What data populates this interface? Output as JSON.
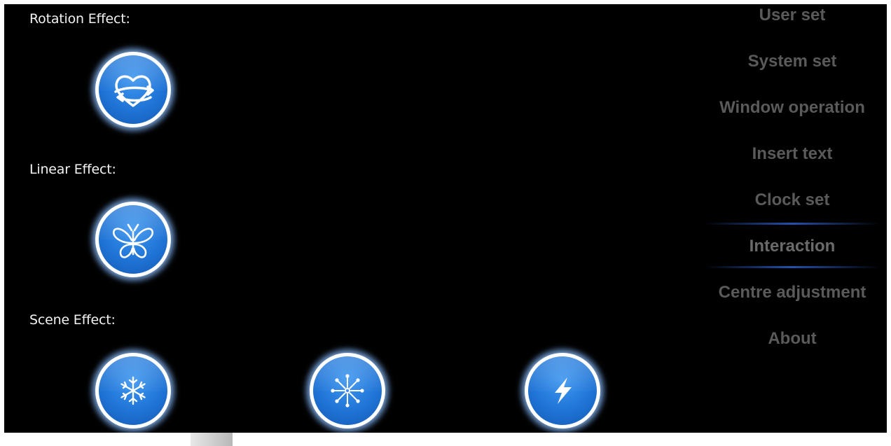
{
  "sections": {
    "rotation_label": "Rotation Effect:",
    "linear_label": "Linear Effect:",
    "scene_label": "Scene Effect:"
  },
  "buttons": {
    "rotation": "heart-arrows-icon",
    "linear": "butterfly-icon",
    "scene_1": "snowflake-icon",
    "scene_2": "firework-icon",
    "scene_3": "lightning-icon"
  },
  "menu": {
    "items": [
      {
        "label": "User set"
      },
      {
        "label": "System set"
      },
      {
        "label": "Window operation"
      },
      {
        "label": "Insert text"
      },
      {
        "label": "Clock set"
      },
      {
        "label": "Interaction"
      },
      {
        "label": "Centre adjustment"
      },
      {
        "label": "About"
      }
    ],
    "selected": "Interaction"
  },
  "colors": {
    "background": "#000000",
    "button_blue": "#1f74d6",
    "menu_text": "#5a5a5a",
    "selection_line": "#285abe"
  }
}
